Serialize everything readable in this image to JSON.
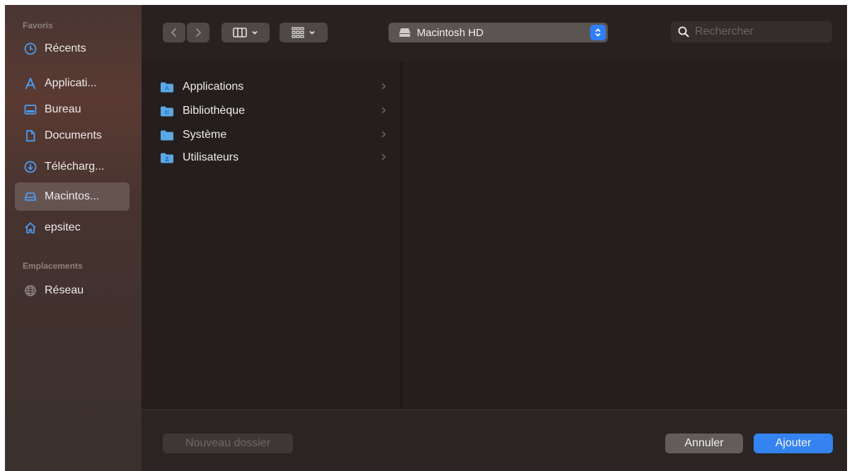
{
  "sidebar": {
    "favorites_title": "Favoris",
    "favorites": [
      {
        "label": "Récents",
        "icon": "clock-icon"
      },
      {
        "label": "Applicati...",
        "icon": "applications-icon"
      },
      {
        "label": "Bureau",
        "icon": "desktop-icon"
      },
      {
        "label": "Documents",
        "icon": "document-icon"
      },
      {
        "label": "Télécharg...",
        "icon": "download-icon"
      },
      {
        "label": "Macintos...",
        "icon": "hard-drive-icon",
        "selected": true
      },
      {
        "label": "epsitec",
        "icon": "home-icon"
      }
    ],
    "locations_title": "Emplacements",
    "locations": [
      {
        "label": "Réseau",
        "icon": "network-globe-icon"
      }
    ]
  },
  "toolbar": {
    "location": "Macintosh HD",
    "search_placeholder": "Rechercher"
  },
  "files": [
    {
      "name": "Applications"
    },
    {
      "name": "Bibliothèque"
    },
    {
      "name": "Système"
    },
    {
      "name": "Utilisateurs"
    }
  ],
  "footer": {
    "new_folder_label": "Nouveau dossier",
    "cancel_label": "Annuler",
    "add_label": "Ajouter"
  },
  "colors": {
    "accent": "#3583f0",
    "sidebar_icon": "#4a9cf2",
    "folder": "#5aa8e6"
  }
}
